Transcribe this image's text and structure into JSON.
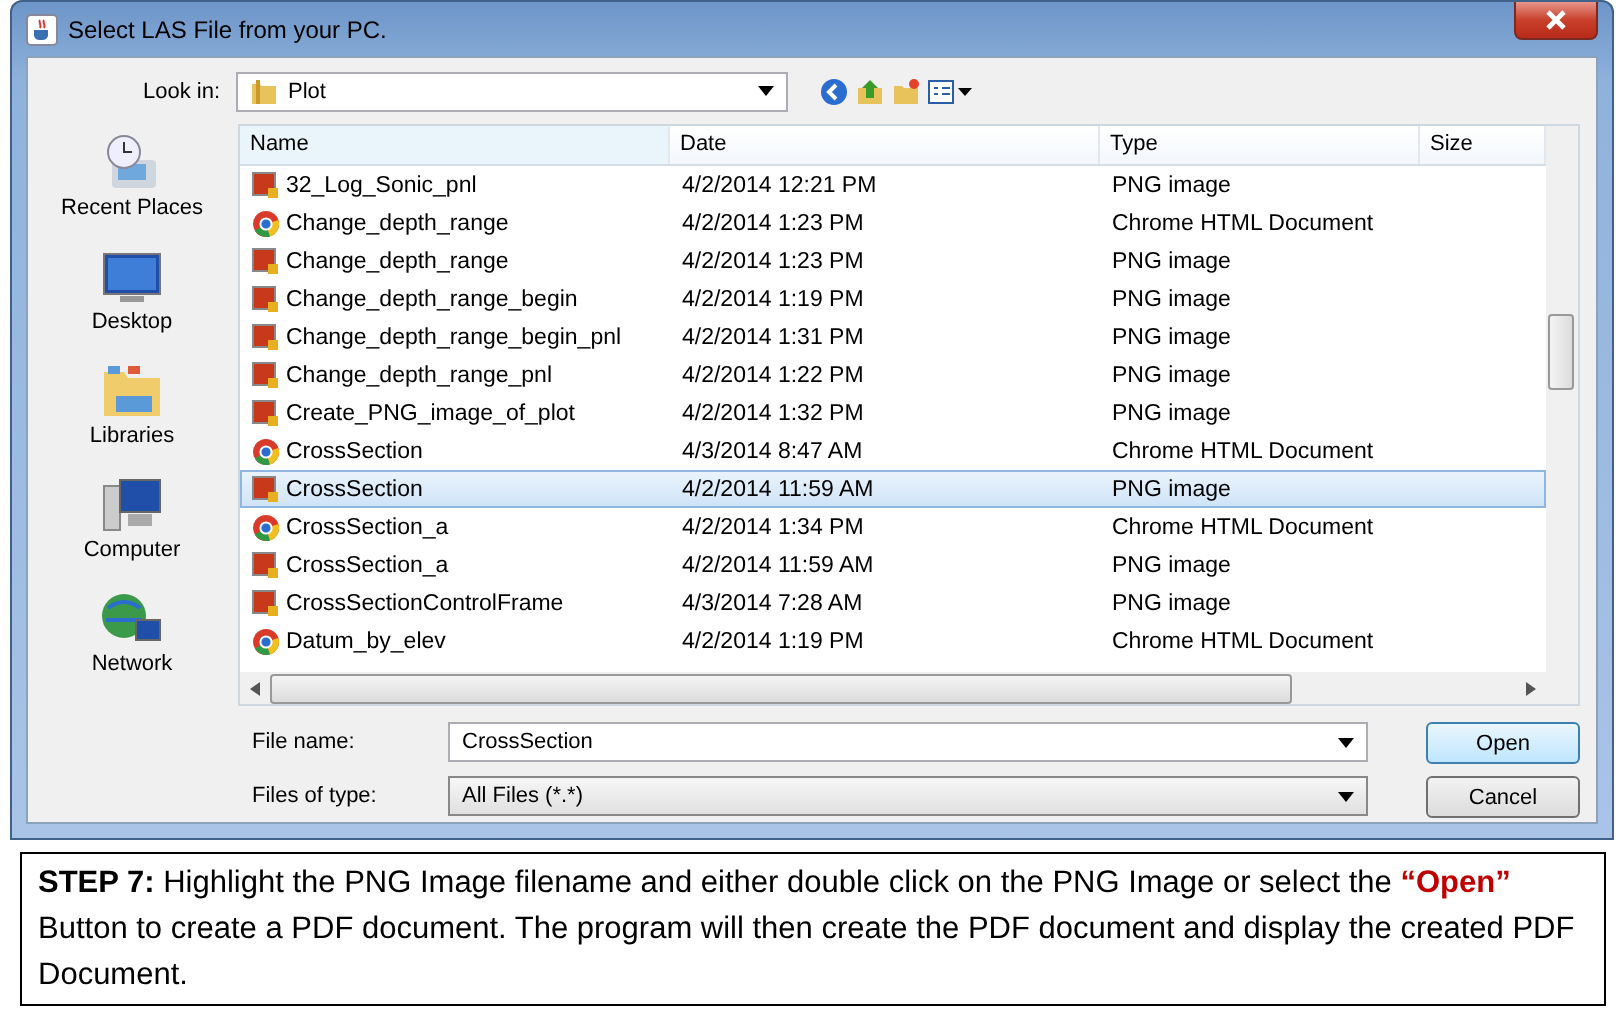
{
  "window": {
    "title": "Select LAS File from your PC."
  },
  "look_in": {
    "label": "Look in:",
    "value": "Plot"
  },
  "places": [
    {
      "kind": "recent",
      "label": "Recent Places"
    },
    {
      "kind": "desktop",
      "label": "Desktop"
    },
    {
      "kind": "libraries",
      "label": "Libraries"
    },
    {
      "kind": "computer",
      "label": "Computer"
    },
    {
      "kind": "network",
      "label": "Network"
    }
  ],
  "table": {
    "columns": [
      "Name",
      "Date",
      "Type",
      "Size"
    ],
    "rows": [
      {
        "kind": "png",
        "name": "32_Log_Sonic_pnl",
        "date": "4/2/2014 12:21 PM",
        "type": "PNG image",
        "selected": false
      },
      {
        "kind": "chrome",
        "name": "Change_depth_range",
        "date": "4/2/2014 1:23 PM",
        "type": "Chrome HTML Document",
        "selected": false
      },
      {
        "kind": "png",
        "name": "Change_depth_range",
        "date": "4/2/2014 1:23 PM",
        "type": "PNG image",
        "selected": false
      },
      {
        "kind": "png",
        "name": "Change_depth_range_begin",
        "date": "4/2/2014 1:19 PM",
        "type": "PNG image",
        "selected": false
      },
      {
        "kind": "png",
        "name": "Change_depth_range_begin_pnl",
        "date": "4/2/2014 1:31 PM",
        "type": "PNG image",
        "selected": false
      },
      {
        "kind": "png",
        "name": "Change_depth_range_pnl",
        "date": "4/2/2014 1:22 PM",
        "type": "PNG image",
        "selected": false
      },
      {
        "kind": "png",
        "name": "Create_PNG_image_of_plot",
        "date": "4/2/2014 1:32 PM",
        "type": "PNG image",
        "selected": false
      },
      {
        "kind": "chrome",
        "name": "CrossSection",
        "date": "4/3/2014 8:47 AM",
        "type": "Chrome HTML Document",
        "selected": false
      },
      {
        "kind": "png",
        "name": "CrossSection",
        "date": "4/2/2014 11:59 AM",
        "type": "PNG image",
        "selected": true
      },
      {
        "kind": "chrome",
        "name": "CrossSection_a",
        "date": "4/2/2014 1:34 PM",
        "type": "Chrome HTML Document",
        "selected": false
      },
      {
        "kind": "png",
        "name": "CrossSection_a",
        "date": "4/2/2014 11:59 AM",
        "type": "PNG image",
        "selected": false
      },
      {
        "kind": "png",
        "name": "CrossSectionControlFrame",
        "date": "4/3/2014 7:28 AM",
        "type": "PNG image",
        "selected": false
      },
      {
        "kind": "chrome",
        "name": "Datum_by_elev",
        "date": "4/2/2014 1:19 PM",
        "type": "Chrome HTML Document",
        "selected": false
      }
    ]
  },
  "file_name": {
    "label": "File name:",
    "value": "CrossSection"
  },
  "file_type": {
    "label": "Files of type:",
    "value": "All Files (*.*)"
  },
  "buttons": [
    "Open",
    "Cancel"
  ],
  "caption": {
    "step": "STEP 7:",
    "before": " Highlight the PNG Image filename and either double click on the PNG Image or select the ",
    "highlight": "“Open”",
    "after": " Button to create a PDF document.  The program will then create the PDF document and display the created PDF Document."
  }
}
